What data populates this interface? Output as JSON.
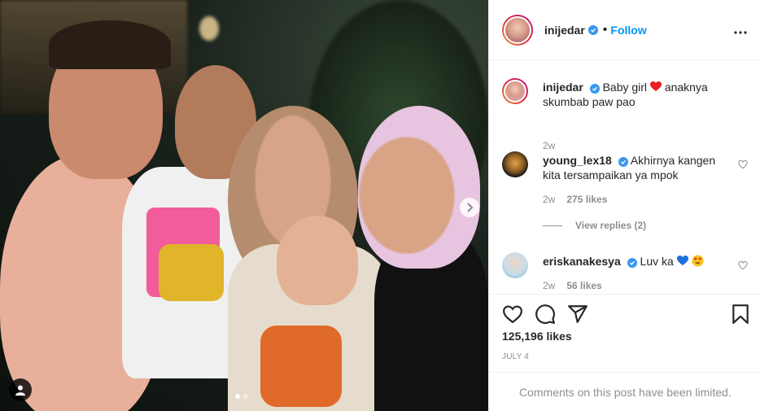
{
  "post": {
    "author": "inijedar",
    "follow_label": "Follow",
    "more_label": "•••",
    "caption": {
      "username": "inijedar",
      "text_before": "Baby girl",
      "text_after": "anaknya skumbab paw pao",
      "time": "2w"
    },
    "comments": [
      {
        "username": "young_lex18",
        "text": "Akhirnya kangen kita tersampaikan ya mpok",
        "time": "2w",
        "likes": "275 likes",
        "view_replies": "View replies (2)"
      },
      {
        "username": "eriskanakesya",
        "text_before": "Luv ka",
        "time": "2w",
        "likes": "56 likes"
      }
    ],
    "likes": "125,196 likes",
    "date": "JULY 4",
    "limited_notice": "Comments on this post have been limited."
  },
  "colors": {
    "accent": "#0095f6",
    "verified": "#3897f0",
    "heart_red": "#ed1c24",
    "heart_blue": "#1e6fd9",
    "muted": "#8e8e8e"
  },
  "icons": [
    "chevron-right-icon",
    "user-tag-icon",
    "verified-icon",
    "heart-icon",
    "comment-icon",
    "share-icon",
    "bookmark-icon",
    "more-icon"
  ],
  "carousel": {
    "total": 2,
    "active": 1
  }
}
